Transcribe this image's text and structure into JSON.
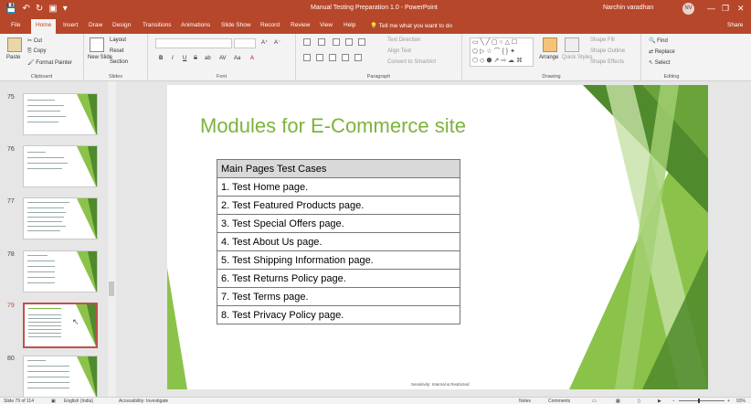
{
  "window": {
    "title": "Manual Testing Preparation 1.0  -  PowerPoint",
    "user": "Narchin varadhan",
    "avatar_initials": "NV",
    "minimize": "—",
    "restore": "❐",
    "close": "✕"
  },
  "quick_access": {
    "save": "💾",
    "undo": "↶",
    "redo": "↻",
    "present": "▣",
    "more": "▾"
  },
  "tabs": [
    "File",
    "Home",
    "Insert",
    "Draw",
    "Design",
    "Transitions",
    "Animations",
    "Slide Show",
    "Record",
    "Review",
    "View",
    "Help"
  ],
  "active_tab": "Home",
  "tell_me": "Tell me what you want to do",
  "share": "Share",
  "ribbon": {
    "clipboard": {
      "label": "Clipboard",
      "paste": "Paste",
      "cut": "Cut",
      "copy": "Copy",
      "format_painter": "Format Painter"
    },
    "slides": {
      "label": "Slides",
      "new_slide": "New Slide",
      "layout": "Layout",
      "reset": "Reset",
      "section": "Section"
    },
    "font": {
      "label": "Font",
      "bold": "B",
      "italic": "I",
      "underline": "U",
      "strike": "S",
      "shadow": "ab",
      "spacing": "AV",
      "case": "Aa"
    },
    "paragraph": {
      "label": "Paragraph",
      "text_direction": "Text Direction",
      "align_text": "Align Text",
      "convert_smartart": "Convert to SmartArt"
    },
    "drawing": {
      "label": "Drawing",
      "arrange": "Arrange",
      "quick_styles": "Quick Styles",
      "shape_fill": "Shape Fill",
      "shape_outline": "Shape Outline",
      "shape_effects": "Shape Effects"
    },
    "editing": {
      "label": "Editing",
      "find": "Find",
      "replace": "Replace",
      "select": "Select"
    }
  },
  "thumbnails": [
    {
      "number": "75"
    },
    {
      "number": "76"
    },
    {
      "number": "77"
    },
    {
      "number": "78"
    },
    {
      "number": "79",
      "selected": true
    },
    {
      "number": "80"
    }
  ],
  "slide": {
    "title": "Modules for E-Commerce site",
    "table": {
      "header": "Main Pages Test Cases",
      "rows": [
        "1. Test Home page.",
        "2. Test Featured Products page.",
        "3. Test Special Offers page.",
        "4. Test About Us page.",
        "5. Test Shipping Information page.",
        "6. Test Returns Policy page.",
        "7. Test Terms page.",
        "8. Test Privacy Policy page."
      ]
    },
    "footnote": "Sensitivity: Internal & Restricted",
    "colors": {
      "title": "#7db33b",
      "light_green": "#8bc34a",
      "dark_green": "#4f8a2c"
    }
  },
  "status": {
    "slide_count": "Slide 79 of 114",
    "language": "English (India)",
    "accessibility": "Accessibility: Investigate",
    "notes": "Notes",
    "comments": "Comments",
    "zoom": "93%"
  }
}
